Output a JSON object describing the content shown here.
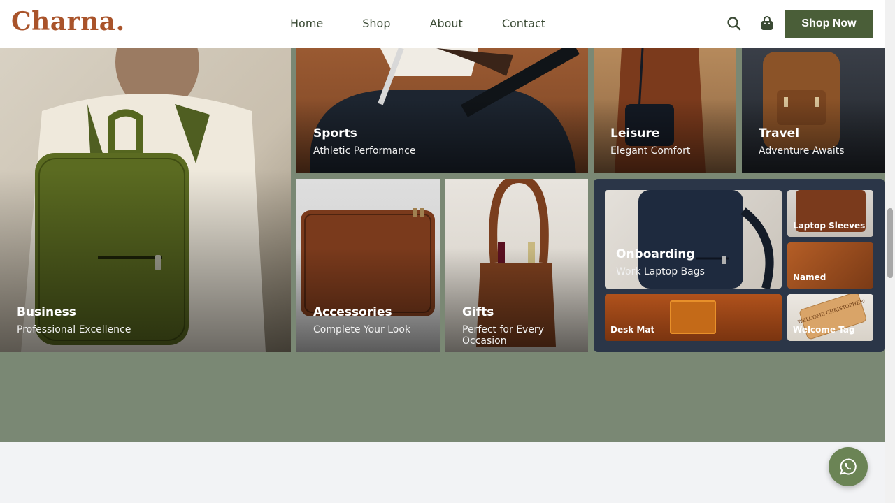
{
  "header": {
    "logo": "Charna.",
    "nav": [
      "Home",
      "Shop",
      "About",
      "Contact"
    ],
    "shop_now": "Shop Now",
    "icons": [
      "search-icon",
      "shopping-bag-icon"
    ]
  },
  "categories": {
    "business": {
      "title": "Business",
      "subtitle": "Professional Excellence"
    },
    "sports": {
      "title": "Sports",
      "subtitle": "Athletic Performance"
    },
    "leisure": {
      "title": "Leisure",
      "subtitle": "Elegant Comfort"
    },
    "travel": {
      "title": "Travel",
      "subtitle": "Adventure Awaits"
    },
    "accessories": {
      "title": "Accessories",
      "subtitle": "Complete Your Look"
    },
    "gifts": {
      "title": "Gifts",
      "subtitle": "Perfect for Every Occasion"
    }
  },
  "onboarding": {
    "title": "Onboarding",
    "subtitle": "Work Laptop Bags",
    "items": [
      "Laptop Sleeves",
      "Named",
      "Desk Mat",
      "Welcome Tag"
    ],
    "tag_text": "WELCOME CHRISTOPHER!"
  },
  "colors": {
    "brand": "#a9532a",
    "primary_button": "#4a5e38",
    "section_bg": "#7a8874",
    "onboarding_panel": "#2b3648",
    "chat_button": "#6b8455"
  },
  "chat": {
    "icon": "whatsapp-icon"
  }
}
